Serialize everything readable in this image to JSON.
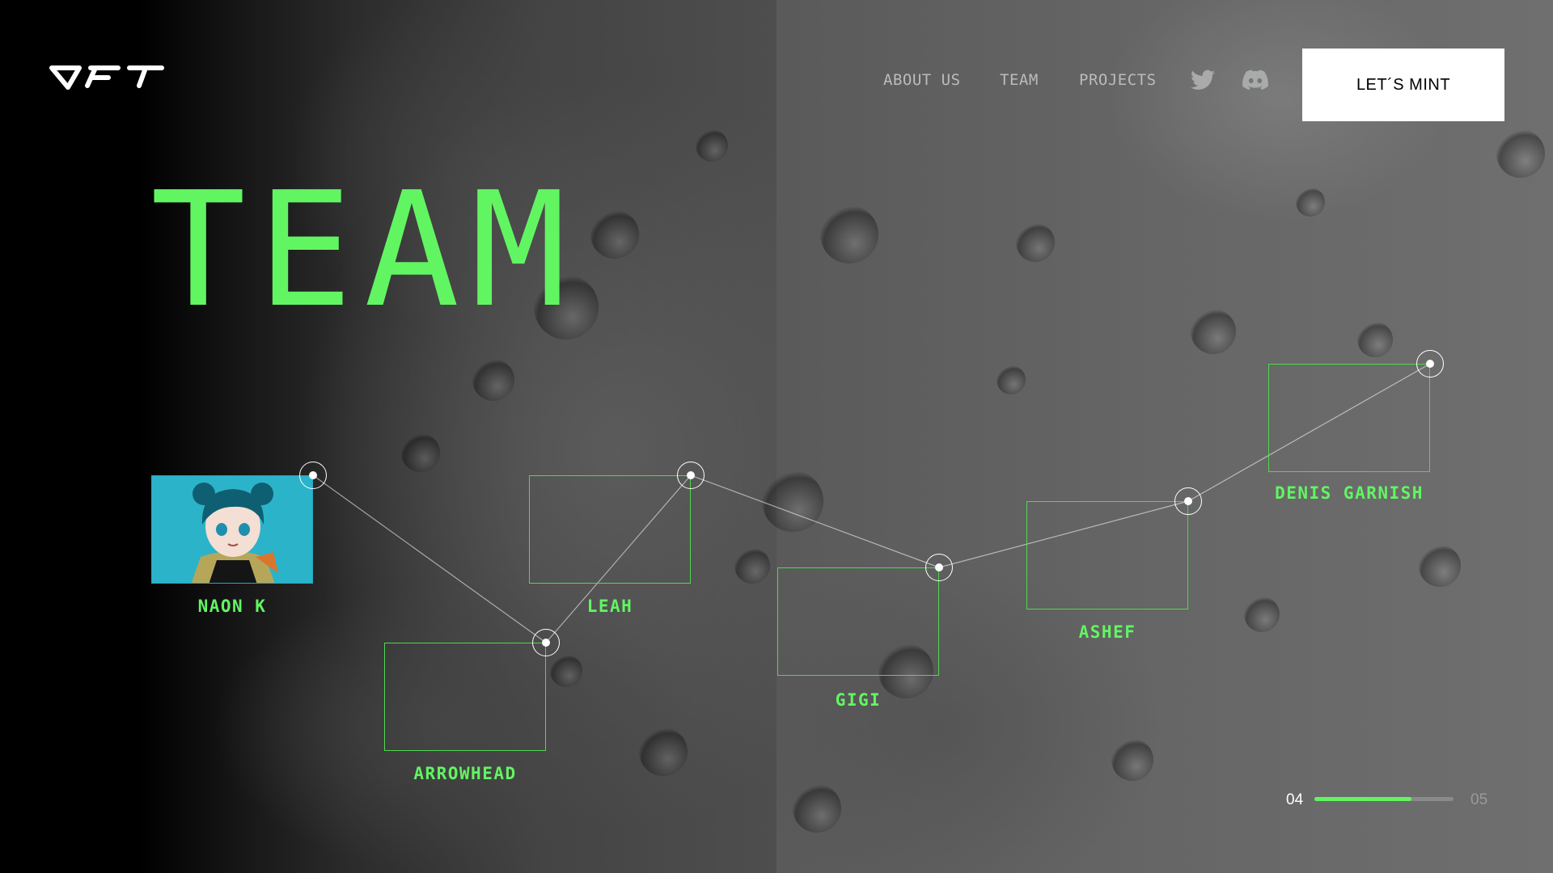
{
  "brand": {
    "logo_icon": "oft-logo-icon"
  },
  "nav": {
    "links": [
      "ABOUT US",
      "TEAM",
      "PROJECTS"
    ],
    "social": [
      "twitter-icon",
      "discord-icon"
    ],
    "cta": "LET´S MINT"
  },
  "page_title": "TEAM",
  "team": {
    "members": [
      {
        "name": "NAON K",
        "has_avatar": true
      },
      {
        "name": "ARROWHEAD",
        "has_avatar": false
      },
      {
        "name": "LEAH",
        "has_avatar": false
      },
      {
        "name": "GIGI",
        "has_avatar": false
      },
      {
        "name": "ASHEF",
        "has_avatar": false
      },
      {
        "name": "DENIS GARNISH",
        "has_avatar": false
      }
    ]
  },
  "pagination": {
    "current": "04",
    "total": "05",
    "progress": 0.7
  },
  "colors": {
    "accent": "#62f562",
    "frame": "#4ed94e",
    "nav_text": "#b9bcbc",
    "cta_bg": "#ffffff"
  }
}
